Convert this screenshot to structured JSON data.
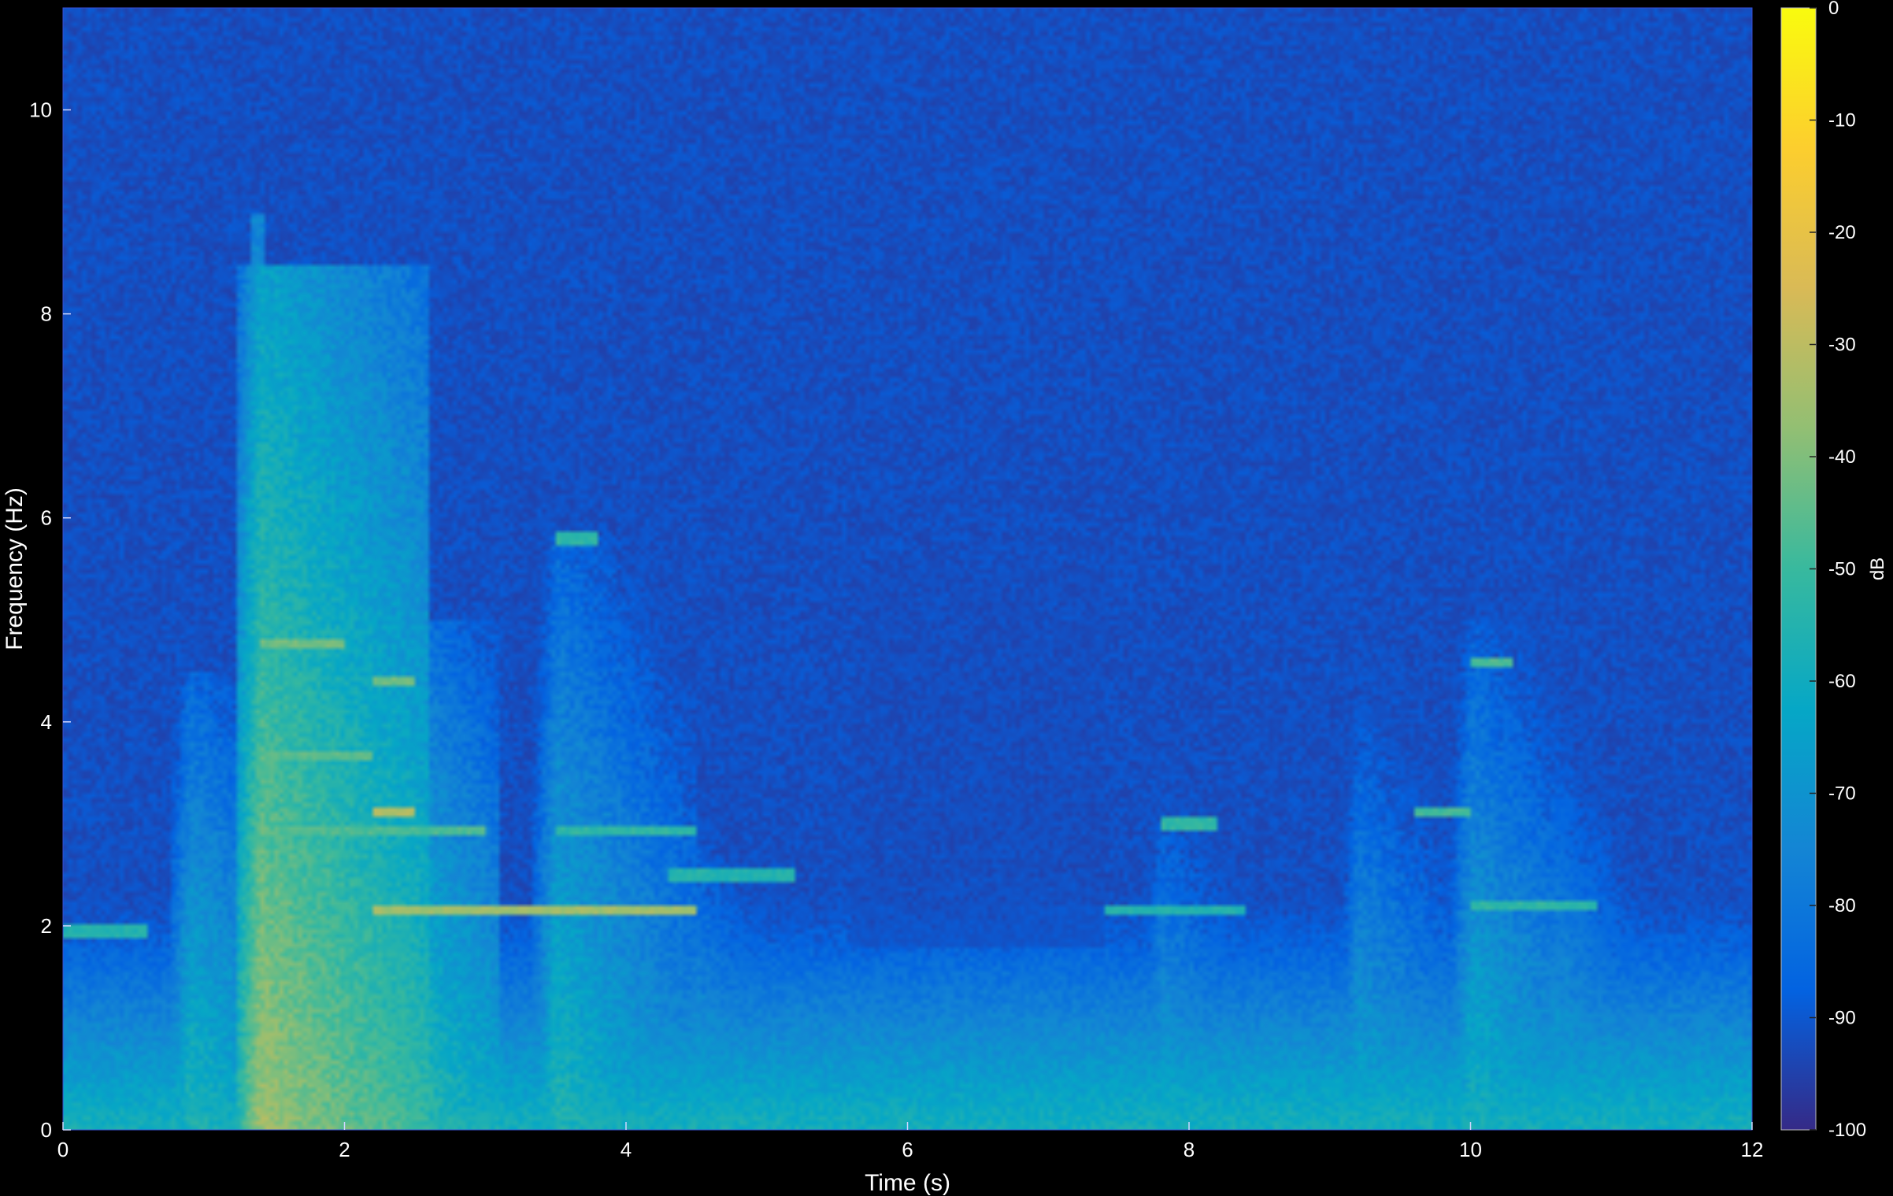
{
  "chart_data": {
    "type": "heatmap",
    "xlabel": "Time (s)",
    "ylabel": "Frequency (Hz)",
    "xlim": [
      0,
      12
    ],
    "ylim": [
      0,
      11
    ],
    "xticks": [
      0,
      2,
      4,
      6,
      8,
      10,
      12
    ],
    "yticks": [
      0,
      2,
      4,
      6,
      8,
      10
    ],
    "colormap": "parula",
    "background_color": "#000000",
    "colorbar": {
      "label": "dB",
      "range": [
        -100,
        0
      ],
      "ticks": [
        0,
        -10,
        -20,
        -30,
        -40,
        -50,
        -60,
        -70,
        -80,
        -90,
        -100
      ],
      "colors": [
        "#352a87",
        "#0363e1",
        "#1485d4",
        "#06a7c6",
        "#38b99e",
        "#92bf73",
        "#d9ba56",
        "#fcce2e",
        "#f9fb0e"
      ]
    },
    "bursts": [
      {
        "t": 0.9,
        "dur": 0.9,
        "height": 4.5,
        "level": -55
      },
      {
        "t": 1.4,
        "dur": 1.2,
        "height": 8.5,
        "level": -35
      },
      {
        "t": 2.2,
        "dur": 0.9,
        "height": 5.0,
        "level": -45
      },
      {
        "t": 3.5,
        "dur": 1.0,
        "height": 5.8,
        "level": -55
      },
      {
        "t": 4.5,
        "dur": 0.8,
        "height": 3.0,
        "level": -62
      },
      {
        "t": 5.2,
        "dur": 0.5,
        "height": 2.5,
        "level": -68
      },
      {
        "t": 6.2,
        "dur": 0.4,
        "height": 2.0,
        "level": -75
      },
      {
        "t": 6.8,
        "dur": 0.8,
        "height": 2.6,
        "level": -66
      },
      {
        "t": 7.8,
        "dur": 0.8,
        "height": 3.3,
        "level": -62
      },
      {
        "t": 9.2,
        "dur": 1.0,
        "height": 4.2,
        "level": -62
      },
      {
        "t": 10.0,
        "dur": 1.0,
        "height": 5.0,
        "level": -58
      },
      {
        "t": 10.6,
        "dur": 0.9,
        "height": 3.5,
        "level": -62
      }
    ],
    "harmonics": [
      {
        "t0": 0.0,
        "t1": 0.6,
        "f": 1.95,
        "level": -58
      },
      {
        "t0": 1.4,
        "t1": 2.0,
        "f": 4.75,
        "level": -45
      },
      {
        "t0": 1.4,
        "t1": 2.2,
        "f": 3.65,
        "level": -48
      },
      {
        "t0": 1.4,
        "t1": 3.0,
        "f": 2.95,
        "level": -50
      },
      {
        "t0": 2.2,
        "t1": 2.5,
        "f": 4.4,
        "level": -45
      },
      {
        "t0": 2.2,
        "t1": 2.5,
        "f": 3.1,
        "level": -35
      },
      {
        "t0": 2.2,
        "t1": 4.5,
        "f": 2.15,
        "level": -38
      },
      {
        "t0": 3.5,
        "t1": 3.8,
        "f": 5.8,
        "level": -55
      },
      {
        "t0": 3.5,
        "t1": 4.5,
        "f": 2.95,
        "level": -55
      },
      {
        "t0": 4.3,
        "t1": 5.2,
        "f": 2.5,
        "level": -58
      },
      {
        "t0": 6.8,
        "t1": 8.4,
        "f": 2.15,
        "level": -58
      },
      {
        "t0": 7.8,
        "t1": 8.2,
        "f": 3.0,
        "level": -55
      },
      {
        "t0": 9.6,
        "t1": 10.0,
        "f": 3.1,
        "level": -52
      },
      {
        "t0": 10.0,
        "t1": 10.3,
        "f": 4.6,
        "level": -50
      },
      {
        "t0": 10.0,
        "t1": 10.9,
        "f": 2.2,
        "level": -55
      }
    ]
  }
}
